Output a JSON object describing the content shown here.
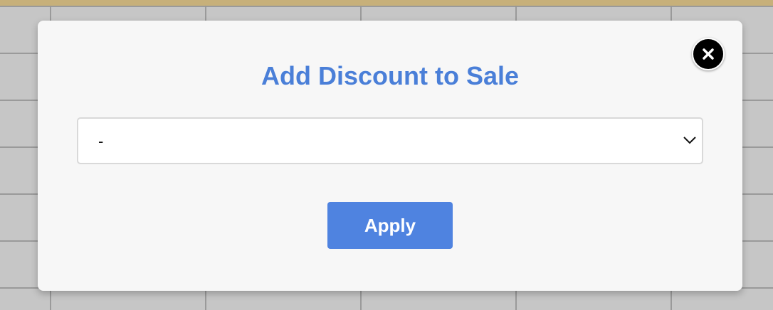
{
  "modal": {
    "title": "Add Discount to Sale",
    "close_icon": "close-icon",
    "discount_select": {
      "selected_value": "-",
      "icon": "chevron-down-icon"
    },
    "apply_label": "Apply"
  },
  "colors": {
    "title": "#4a7fd8",
    "apply_button": "#4f83e0",
    "modal_background": "#f7f7f7",
    "backdrop": "#c6c6c6",
    "top_strip": "#c7b07a"
  }
}
